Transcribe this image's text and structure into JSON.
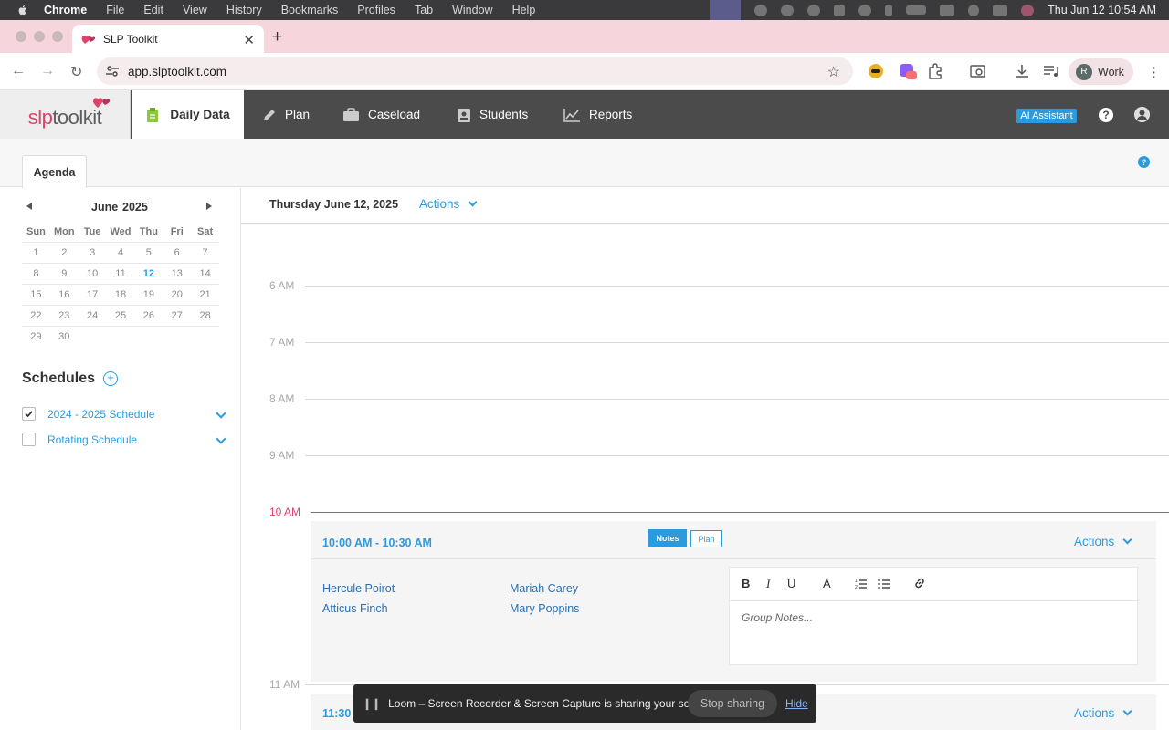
{
  "os_menubar": {
    "app": "Chrome",
    "menus": [
      "File",
      "Edit",
      "View",
      "History",
      "Bookmarks",
      "Profiles",
      "Tab",
      "Window",
      "Help"
    ],
    "clock": "Thu Jun 12  10:54 AM"
  },
  "browser": {
    "tab_title": "SLP Toolkit",
    "url": "app.slptoolkit.com",
    "profile_initial": "R",
    "profile_label": "Work",
    "ext_badge": "8+"
  },
  "app": {
    "logo_slp": "slp",
    "logo_toolkit": "toolkit",
    "nav": [
      {
        "label": "Daily Data",
        "icon": "clipboard-icon",
        "active": true
      },
      {
        "label": "Plan",
        "icon": "pencil-icon"
      },
      {
        "label": "Caseload",
        "icon": "briefcase-icon"
      },
      {
        "label": "Students",
        "icon": "id-badge-icon"
      },
      {
        "label": "Reports",
        "icon": "chart-line-icon"
      }
    ],
    "ai_assistant": "AI Assistant",
    "help_glyph": "?"
  },
  "subbar": {
    "tab": "Agenda",
    "help_glyph": "?"
  },
  "calendar": {
    "month": "June",
    "year": "2025",
    "days": [
      "Sun",
      "Mon",
      "Tue",
      "Wed",
      "Thu",
      "Fri",
      "Sat"
    ],
    "weeks": [
      [
        "1",
        "2",
        "3",
        "4",
        "5",
        "6",
        "7"
      ],
      [
        "8",
        "9",
        "10",
        "11",
        "12",
        "13",
        "14"
      ],
      [
        "15",
        "16",
        "17",
        "18",
        "19",
        "20",
        "21"
      ],
      [
        "22",
        "23",
        "24",
        "25",
        "26",
        "27",
        "28"
      ],
      [
        "29",
        "30",
        "",
        "",
        "",
        "",
        ""
      ]
    ],
    "today": "12"
  },
  "schedules": {
    "title": "Schedules",
    "items": [
      {
        "label": "2024 - 2025 Schedule",
        "checked": true
      },
      {
        "label": "Rotating Schedule",
        "checked": false
      }
    ]
  },
  "day": {
    "date": "Thursday June 12, 2025",
    "actions": "Actions",
    "hours": [
      "6 AM",
      "7 AM",
      "8 AM",
      "9 AM",
      "10 AM",
      "11 AM"
    ]
  },
  "session": {
    "time": "10:00 AM - 10:30 AM",
    "notes_btn": "Notes",
    "plan_btn": "Plan",
    "actions": "Actions",
    "students": [
      "Hercule Poirot",
      "Atticus Finch",
      "Mariah Carey",
      "Mary Poppins"
    ],
    "editor_tools": [
      "B",
      "I",
      "U",
      "A"
    ],
    "placeholder": "Group Notes..."
  },
  "session2": {
    "time": "11:30",
    "actions": "Actions"
  },
  "loom": {
    "message": "Loom – Screen Recorder & Screen Capture is sharing your screen.",
    "stop": "Stop sharing",
    "hide": "Hide"
  },
  "colors": {
    "accent": "#2b9be0",
    "brand": "#e0436a",
    "nav_bg": "#4b4b4b"
  }
}
